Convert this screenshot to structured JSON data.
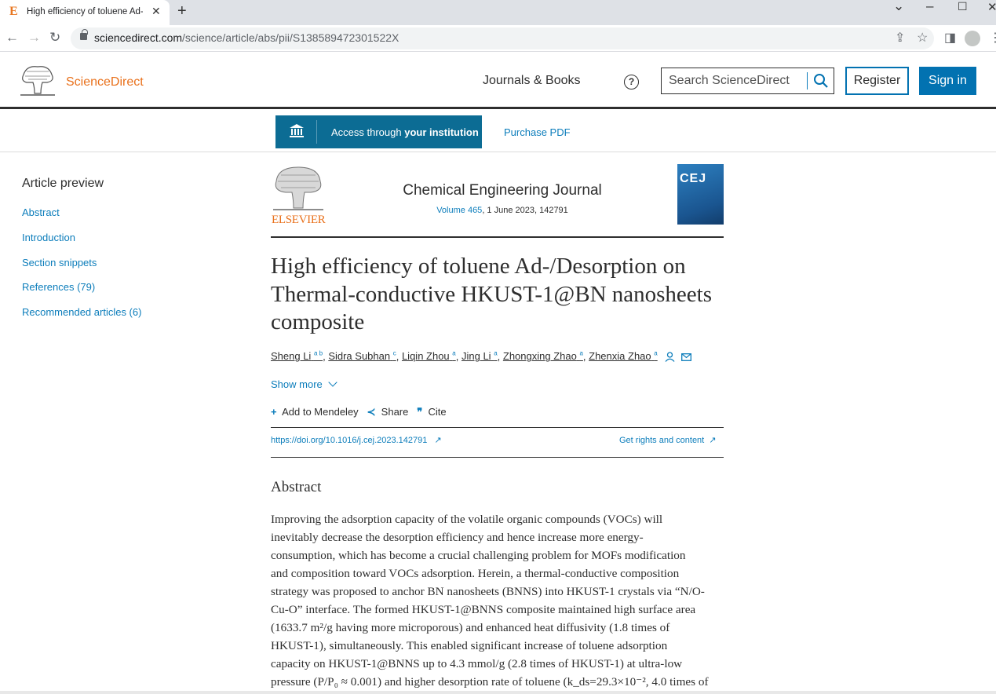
{
  "browser": {
    "tab_title": "High efficiency of toluene Ad-/Desorption",
    "favicon_letter": "E",
    "url_host": "sciencedirect.com",
    "url_path": "/science/article/abs/pii/S138589472301522X"
  },
  "header": {
    "logo_text": "ScienceDirect",
    "nav_journals": "Journals & Books",
    "help": "?",
    "search_placeholder": "Search ScienceDirect",
    "register": "Register",
    "signin": "Sign in"
  },
  "access": {
    "access_prefix": "Access through ",
    "access_bold": "your institution",
    "purchase": "Purchase PDF"
  },
  "sidebar": {
    "title": "Article preview",
    "items": [
      "Abstract",
      "Introduction",
      "Section snippets",
      "References (79)",
      "Recommended articles (6)"
    ]
  },
  "journal": {
    "publisher": "ELSEVIER",
    "name": "Chemical Engineering Journal",
    "volume_link": "Volume 465",
    "volume_rest": ", 1 June 2023, 142791",
    "cover_text": "CEJ"
  },
  "article": {
    "title_lines": [
      "High efficiency of toluene Ad-/Desorption on",
      "Thermal-conductive HKUST-1@BN nanosheets",
      "composite"
    ],
    "authors": [
      {
        "name": "Sheng Li",
        "sup": "a b"
      },
      {
        "name": "Sidra Subhan",
        "sup": "c"
      },
      {
        "name": "Liqin Zhou",
        "sup": "a"
      },
      {
        "name": "Jing Li",
        "sup": "a"
      },
      {
        "name": "Zhongxing Zhao",
        "sup": "a"
      },
      {
        "name": "Zhenxia Zhao",
        "sup": "a"
      }
    ],
    "show_more": "Show more",
    "actions": {
      "mendeley": "Add to Mendeley",
      "share": "Share",
      "cite": "Cite"
    },
    "doi": "https://doi.org/10.1016/j.cej.2023.142791",
    "rights": "Get rights and content"
  },
  "abstract": {
    "heading": "Abstract",
    "lines": [
      "Improving the adsorption capacity of the volatile organic compounds (VOCs) will",
      "inevitably decrease the desorption efficiency and hence increase more energy-",
      "consumption, which has become a crucial challenging problem for MOFs modification",
      "and composition toward VOCs adsorption. Herein, a thermal-conductive composition",
      "strategy was proposed to anchor BN nanosheets (BNNS) into HKUST-1 crystals via “N/O-",
      "Cu-O” interface. The formed HKUST-1@BNNS composite maintained high surface area",
      "(1633.7 m²/g having more microporous) and enhanced heat diffusivity (1.8 times of",
      "HKUST-1), simultaneously. This enabled significant increase of toluene adsorption",
      "capacity on HKUST-1@BNNS up to 4.3 mmol/g (2.8 times of HKUST-1) at ultra-low",
      "pressure (P/P₀ ≈ 0.001) and higher desorption rate of toluene (k_ds=29.3×10⁻², 4.0 times of"
    ]
  }
}
